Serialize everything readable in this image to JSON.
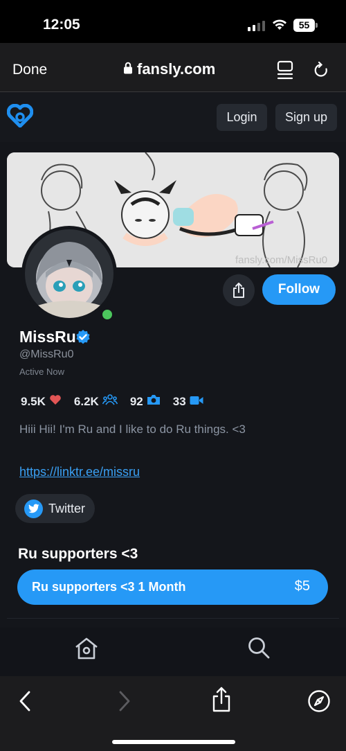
{
  "status_bar": {
    "time": "12:05",
    "battery": "55"
  },
  "browser": {
    "done_label": "Done",
    "url": "fansly.com"
  },
  "header": {
    "login_label": "Login",
    "signup_label": "Sign up"
  },
  "banner": {
    "watermark": "fansly.com/MissRu0"
  },
  "profile": {
    "name": "MissRu",
    "handle": "@MissRu0",
    "status": "Active Now",
    "follow_label": "Follow",
    "stats": {
      "likes": "9.5K",
      "followers": "6.2K",
      "photos": "92",
      "videos": "33"
    },
    "bio": "Hiii Hii! I'm Ru and I like to do Ru things. <3",
    "link": "https://linktr.ee/missru",
    "social_label": "Twitter"
  },
  "subscriptions": {
    "title": "Ru supporters <3",
    "tier_label": "Ru supporters <3 1 Month",
    "tier_price": "$5"
  },
  "colors": {
    "accent": "#2699f6",
    "background": "#14161b",
    "heart": "#e25555",
    "online": "#4cc65d"
  },
  "icons": [
    "fansly-logo-icon",
    "lock-icon",
    "tabs-icon",
    "reload-icon",
    "share-icon",
    "verified-icon",
    "heart-icon",
    "users-icon",
    "camera-icon",
    "video-icon",
    "twitter-icon",
    "home-icon",
    "search-icon",
    "back-icon",
    "forward-icon",
    "safari-share-icon",
    "compass-icon"
  ]
}
